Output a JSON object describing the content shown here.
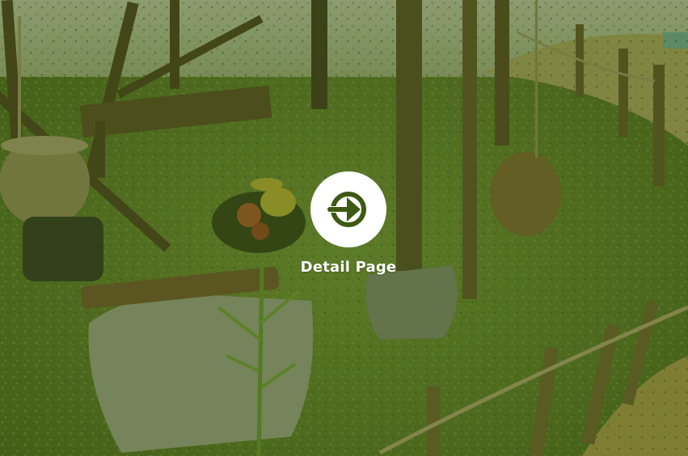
{
  "cta": {
    "label": "Detail Page",
    "icon": "arrow-right-icon",
    "background": "#ffffff",
    "icon_color": "#3d5a14",
    "text_color": "#ffffff"
  },
  "overlay": {
    "color": "#3a520e"
  }
}
